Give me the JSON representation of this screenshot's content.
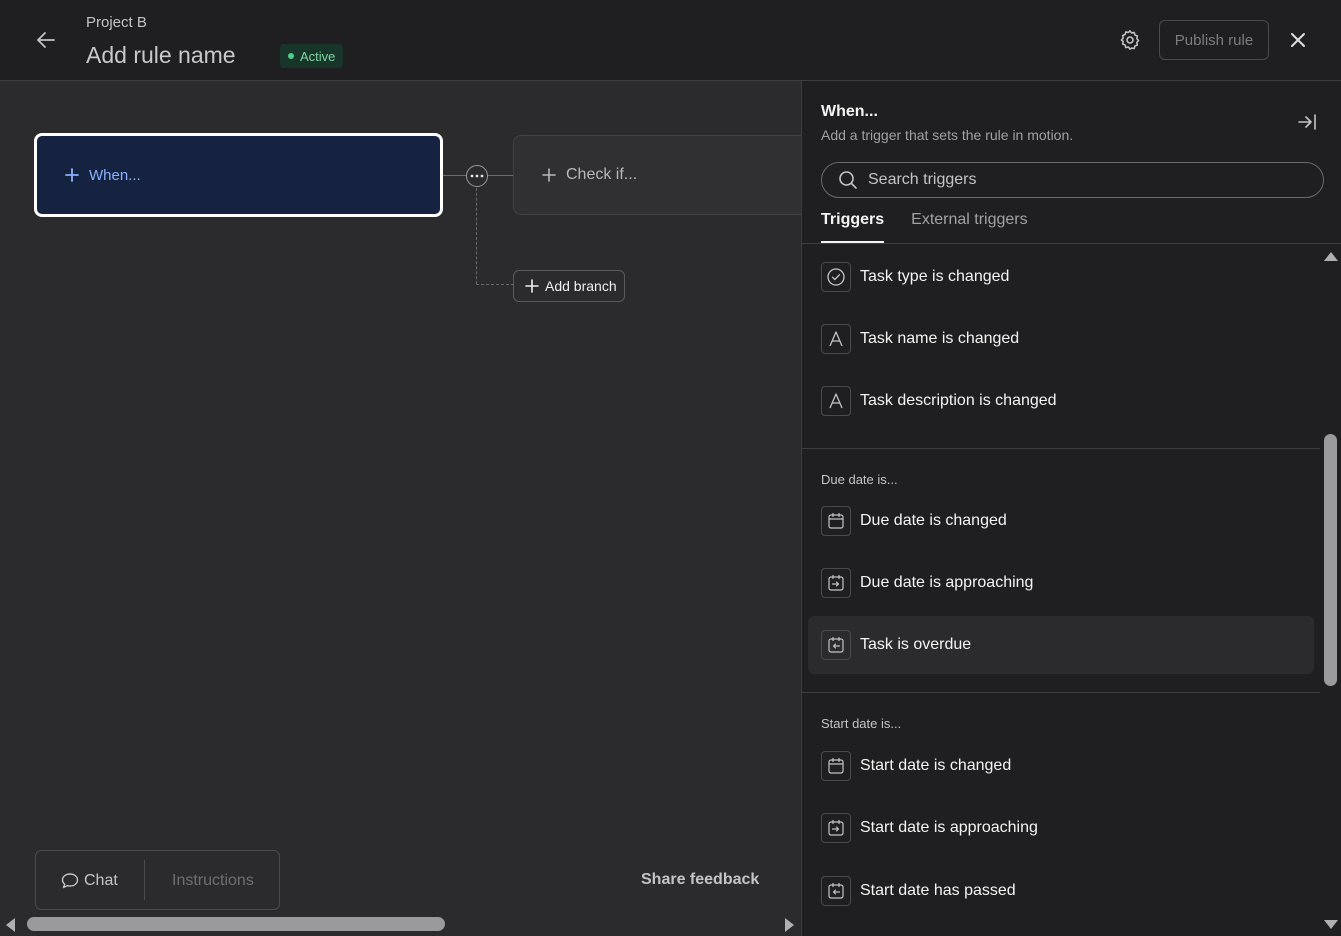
{
  "header": {
    "project": "Project B",
    "rule_name": "Add rule name",
    "status": "Active",
    "publish_label": "Publish rule"
  },
  "canvas": {
    "when_label": "When...",
    "check_label": "Check if...",
    "add_branch_label": "Add branch",
    "chat_label": "Chat",
    "instructions_label": "Instructions",
    "share_feedback_label": "Share feedback"
  },
  "panel": {
    "title": "When...",
    "subtitle": "Add a trigger that sets the rule in motion.",
    "search_placeholder": "Search triggers",
    "tabs": [
      {
        "label": "Triggers"
      },
      {
        "label": "External triggers"
      }
    ],
    "items": [
      {
        "label": "Task type is changed",
        "icon": "check-circle-icon"
      },
      {
        "label": "Task name is changed",
        "icon": "text-a-icon"
      },
      {
        "label": "Task description is changed",
        "icon": "text-a-icon"
      }
    ],
    "sections": [
      {
        "label": "Due date is...",
        "items": [
          {
            "label": "Due date is changed",
            "icon": "calendar-icon"
          },
          {
            "label": "Due date is approaching",
            "icon": "calendar-arrow-in-icon"
          },
          {
            "label": "Task is overdue",
            "icon": "calendar-arrow-out-icon"
          }
        ]
      },
      {
        "label": "Start date is...",
        "items": [
          {
            "label": "Start date is changed",
            "icon": "calendar-icon"
          },
          {
            "label": "Start date is approaching",
            "icon": "calendar-arrow-in-icon"
          },
          {
            "label": "Start date has passed",
            "icon": "calendar-arrow-out-icon"
          }
        ]
      }
    ]
  },
  "colors": {
    "accent_blue": "#8bb0ff",
    "status_green": "#4fcf8a",
    "panel_bg": "#1f1f21",
    "canvas_bg": "#2b2b2d"
  }
}
